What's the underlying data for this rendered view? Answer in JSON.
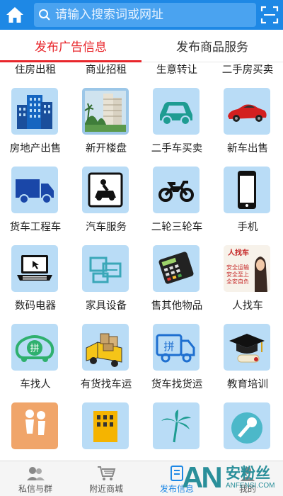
{
  "header": {
    "search_placeholder": "请输入搜索词或网址"
  },
  "tabs": [
    {
      "label": "发布广告信息",
      "active": true
    },
    {
      "label": "发布商品服务",
      "active": false
    }
  ],
  "categories": [
    {
      "label": "住房出租",
      "icon": "house-rent-icon"
    },
    {
      "label": "商业招租",
      "icon": "money-icon"
    },
    {
      "label": "生意转让",
      "icon": "store-transfer-icon"
    },
    {
      "label": "二手房买卖",
      "icon": "handshake-icon"
    },
    {
      "label": "房地产出售",
      "icon": "building-icon"
    },
    {
      "label": "新开楼盘",
      "icon": "new-estate-photo-icon"
    },
    {
      "label": "二手车买卖",
      "icon": "car-icon"
    },
    {
      "label": "新车出售",
      "icon": "red-sports-car-icon"
    },
    {
      "label": "货车工程车",
      "icon": "truck-icon"
    },
    {
      "label": "汽车服务",
      "icon": "car-repair-icon"
    },
    {
      "label": "二轮三轮车",
      "icon": "motorcycle-icon"
    },
    {
      "label": "手机",
      "icon": "mobile-phone-icon"
    },
    {
      "label": "数码电器",
      "icon": "laptop-icon"
    },
    {
      "label": "家具设备",
      "icon": "furniture-icon"
    },
    {
      "label": "售其他物品",
      "icon": "pos-terminal-icon"
    },
    {
      "label": "人找车",
      "icon": "person-find-car-icon",
      "poster": {
        "title": "人找车",
        "lines": [
          "安全运输",
          "安全至上",
          "全安自负"
        ]
      }
    },
    {
      "label": "车找人",
      "icon": "car-find-person-icon",
      "badge": "拼"
    },
    {
      "label": "有货找车运",
      "icon": "cargo-truck-icon"
    },
    {
      "label": "货车找货运",
      "icon": "truck-find-cargo-icon",
      "badge": "拼"
    },
    {
      "label": "教育培训",
      "icon": "graduation-cap-icon"
    },
    {
      "label": "",
      "icon": "dance-icon"
    },
    {
      "label": "",
      "icon": "hotel-icon"
    },
    {
      "label": "",
      "icon": "palm-tree-icon"
    },
    {
      "label": "",
      "icon": "microphone-icon"
    }
  ],
  "bottom_nav": [
    {
      "label": "私信与群",
      "icon": "chat-group-icon",
      "active": false
    },
    {
      "label": "附近商城",
      "icon": "shopping-cart-icon",
      "active": false
    },
    {
      "label": "发布信息",
      "icon": "publish-icon",
      "active": true
    },
    {
      "label": "我的",
      "icon": "user-icon",
      "active": false
    }
  ],
  "watermark": {
    "big": "AN",
    "cn": "安粉丝",
    "en": "ANFENSI.COM"
  },
  "colors": {
    "primary": "#1e88e5",
    "accent": "#e8262b",
    "icon_bg": "#b9dcf6"
  }
}
